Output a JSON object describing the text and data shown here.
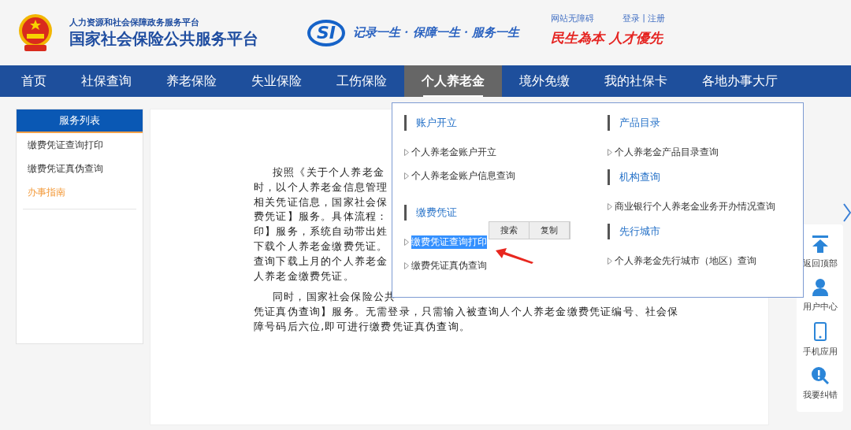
{
  "header": {
    "subtitle": "人力资源和社会保障政务服务平台",
    "title": "国家社会保险公共服务平台",
    "logo_text": "SI",
    "motto": "记录一生 · 保障一生 · 服务一生",
    "accessibility_link": "网站无障碍",
    "login_link": "登录",
    "separator": "|",
    "register_link": "注册",
    "slogan": "民生為本 人才優先"
  },
  "nav": [
    {
      "label": "首页",
      "selected": false
    },
    {
      "label": "社保查询",
      "selected": false
    },
    {
      "label": "养老保险",
      "selected": false
    },
    {
      "label": "失业保险",
      "selected": false
    },
    {
      "label": "工伤保险",
      "selected": false
    },
    {
      "label": "个人养老金",
      "selected": true
    },
    {
      "label": "境外免缴",
      "selected": false
    },
    {
      "label": "我的社保卡",
      "selected": false
    },
    {
      "label": "各地办事大厅",
      "selected": false
    }
  ],
  "sidebar": {
    "title": "服务列表",
    "items": [
      {
        "label": "缴费凭证查询打印",
        "selected": false
      },
      {
        "label": "缴费凭证真伪查询",
        "selected": false
      },
      {
        "label": "办事指南",
        "selected": true
      }
    ]
  },
  "article": {
    "paragraphs": [
      [
        "按照《关于个人养老金",
        "时，以个人养老金信息管理",
        "相关凭证信息，国家社会保",
        "费凭证】服务。具体流程：",
        "印】服务，系统自动带出姓",
        "下载个人养老金缴费凭证。",
        "查询下载上月的个人养老金",
        "人养老金缴费凭证。"
      ],
      [
        "同时，国家社会保险公共",
        "凭证真伪查询】服务。无需登录，只需输入被查询人个人养老金缴费凭证编号、社会保",
        "障号码后六位,即可进行缴费凭证真伪查询。"
      ]
    ]
  },
  "dropdown": {
    "columns": [
      [
        {
          "title": "账户开立",
          "links": [
            {
              "label": "个人养老金账户开立",
              "highlighted": false
            },
            {
              "label": "个人养老金账户信息查询",
              "highlighted": false
            }
          ]
        },
        {
          "title": "缴费凭证",
          "links": [
            {
              "label": "缴费凭证查询打印",
              "highlighted": true
            },
            {
              "label": "缴费凭证真伪查询",
              "highlighted": false
            }
          ]
        }
      ],
      [
        {
          "title": "产品目录",
          "links": [
            {
              "label": "个人养老金产品目录查询",
              "highlighted": false
            }
          ]
        },
        {
          "title": "机构查询",
          "links": [
            {
              "label": "商业银行个人养老金业务开办情况查询",
              "highlighted": false
            }
          ]
        },
        {
          "title": "先行城市",
          "links": [
            {
              "label": "个人养老金先行城市（地区）查询",
              "highlighted": false
            }
          ]
        }
      ]
    ]
  },
  "context_menu": [
    "搜索",
    "复制"
  ],
  "tools": [
    {
      "kind": "top",
      "label": "返回顶部"
    },
    {
      "kind": "user",
      "label": "用户中心"
    },
    {
      "kind": "phone",
      "label": "手机应用"
    },
    {
      "kind": "report",
      "label": "我要纠错"
    }
  ]
}
